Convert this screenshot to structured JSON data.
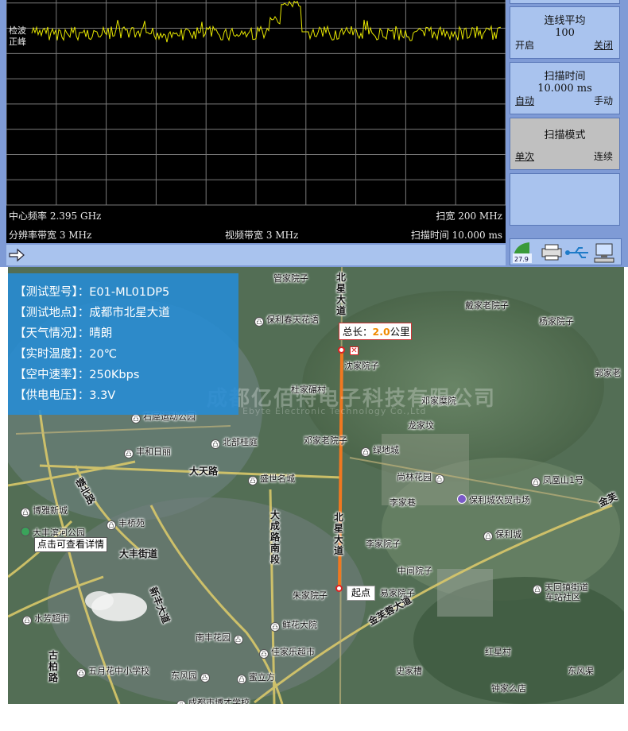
{
  "analyzer": {
    "detector_label": [
      "检波",
      "正峰"
    ],
    "center_freq": "中心频率 2.395 GHz",
    "span": "扫宽 200 MHz",
    "rbw": "分辨率带宽 3 MHz",
    "vbw": "视频带宽 3 MHz",
    "sweep_time_readout": "扫描时间 10.000 ms",
    "trace_color": "#e6e600",
    "softkeys": [
      {
        "title": "连线平均",
        "value": "100",
        "left": "开启",
        "right": "关闭",
        "selected": "right"
      },
      {
        "title": "扫描时间",
        "value": "10.000 ms",
        "left": "自动",
        "right": "手动",
        "selected": "left"
      },
      {
        "title": "扫描模式",
        "value": "",
        "left": "单次",
        "right": "连续",
        "selected": "left"
      },
      {
        "title": "",
        "value": "",
        "left": "",
        "right": "",
        "selected": ""
      }
    ],
    "tray_temp": "27.9"
  },
  "map": {
    "info": [
      "【测试型号】：E01-ML01DP5",
      "【测试地点】：成都市北星大道",
      "【天气情况】：晴朗",
      "【实时温度】：20℃",
      "【空中速率】：250Kbps",
      "【供电电压】：3.3V"
    ],
    "total_label": "总长：",
    "total_value": "2.0",
    "total_unit": "公里",
    "start_label": "起点",
    "detail_label": "点击可查看详情",
    "watermark": "成都亿佰特电子科技有限公司",
    "watermark_en": "Ebyte Electronic Technology Co.,Ltd",
    "route_color": "#f07820",
    "pois": [
      {
        "name": "管家院子",
        "pin": false
      },
      {
        "name": "保利春天花语",
        "pin": true
      },
      {
        "name": "戴家老院子",
        "pin": false
      },
      {
        "name": "杨家院子",
        "pin": false
      },
      {
        "name": "郭家老",
        "pin": false
      },
      {
        "name": "沈家院子",
        "pin": false
      },
      {
        "name": "杜家碾村",
        "pin": false
      },
      {
        "name": "邓家糜院",
        "pin": false
      },
      {
        "name": "石犀运动公园",
        "pin": true
      },
      {
        "name": "龙家坟",
        "pin": false
      },
      {
        "name": "北部桂庭",
        "pin": true
      },
      {
        "name": "邓家老院子",
        "pin": false
      },
      {
        "name": "绿地城",
        "pin": true
      },
      {
        "name": "丰和日丽",
        "pin": true
      },
      {
        "name": "盛世名城",
        "pin": true
      },
      {
        "name": "尚林花园",
        "pin": true
      },
      {
        "name": "凤凰山1号",
        "pin": true
      },
      {
        "name": "李家巷",
        "pin": false
      },
      {
        "name": "保利城农贸市场",
        "pin": true
      },
      {
        "name": "博雅新城",
        "pin": true
      },
      {
        "name": "丰桥苑",
        "pin": true
      },
      {
        "name": "大丰滨河公园",
        "pin": true
      },
      {
        "name": "保利城",
        "pin": true
      },
      {
        "name": "李家院子",
        "pin": false
      },
      {
        "name": "中间院子",
        "pin": false
      },
      {
        "name": "朱家院子",
        "pin": false
      },
      {
        "name": "易家院子",
        "pin": false
      },
      {
        "name": "天回镇街道",
        "pin": true
      },
      {
        "name": "车站社区",
        "pin": false
      },
      {
        "name": "水芳超市",
        "pin": true
      },
      {
        "name": "鲜花大院",
        "pin": true
      },
      {
        "name": "南丰花园",
        "pin": true
      },
      {
        "name": "佳家乐超市",
        "pin": true
      },
      {
        "name": "红星村",
        "pin": false
      },
      {
        "name": "五月花中小学校",
        "pin": true
      },
      {
        "name": "东风园",
        "pin": true
      },
      {
        "name": "蜜立方",
        "pin": true
      },
      {
        "name": "史家槽",
        "pin": false
      },
      {
        "name": "东风渠",
        "pin": false
      },
      {
        "name": "钟家么店",
        "pin": false
      },
      {
        "name": "成都市博才学校",
        "pin": true
      }
    ],
    "roads": [
      "北星大道",
      "大天路",
      "大成路南段",
      "北星大道",
      "大丰街道",
      "新丰大道",
      "金芙蓉大道",
      "古柏路",
      "蓉北路",
      "金芙"
    ]
  }
}
